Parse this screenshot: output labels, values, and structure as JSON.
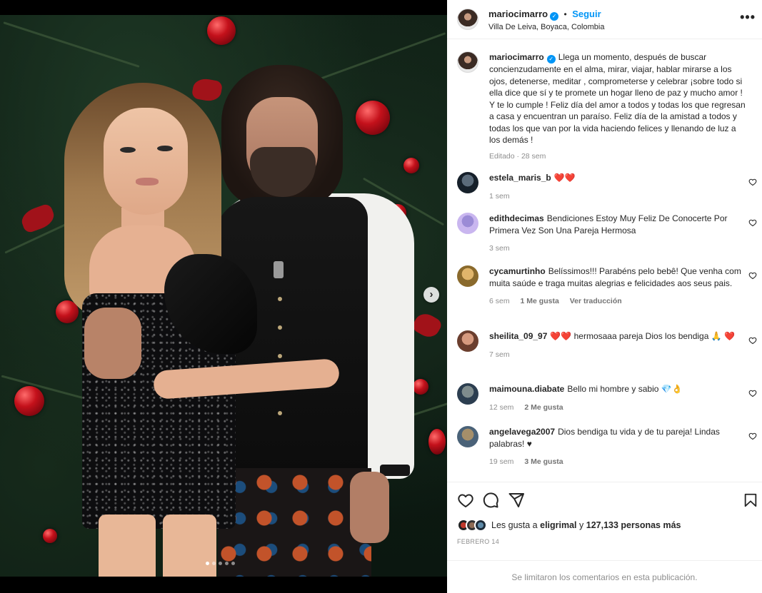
{
  "post": {
    "image_count": 5,
    "current_image": 1,
    "next_icon": "chevron-right-icon"
  },
  "header": {
    "username": "mariocimarro",
    "verified_icon": "verified-badge-icon",
    "separator": "•",
    "follow_label": "Seguir",
    "location": "Villa De Leiva, Boyaca, Colombia",
    "more_icon": "more-options-icon",
    "more_glyph": "•••"
  },
  "caption": {
    "username": "mariocimarro",
    "text": "Llega un momento, después de buscar concienzudamente en el alma, mirar, viajar, hablar mirarse a los ojos, detenerse, meditar , comprometerse y celebrar ¡sobre todo si ella dice que sí y te promete un hogar lleno de paz y mucho amor ! Y te lo cumple ! Feliz día del amor a todos y todas los que regresan a casa y encuentran un paraíso. Feliz día de la amistad a todos y todas los que van por la vida haciendo felices y llenando de luz a los demás !",
    "meta": "Editado · 28 sem"
  },
  "comments": [
    {
      "username": "estela_maris_b",
      "text": "❤️❤️",
      "time": "1 sem",
      "likes": "",
      "extra": ""
    },
    {
      "username": "edithdecimas",
      "text": "Bendiciones Estoy Muy Feliz De Conocerte Por Primera Vez Son Una Pareja Hermosa",
      "time": "3 sem",
      "likes": "",
      "extra": ""
    },
    {
      "username": "cycamurtinho",
      "text": "Belíssimos!!! Parabéns pelo bebê! Que venha com muita saúde e traga muitas alegrias e felicidades aos seus pais.",
      "time": "6 sem",
      "likes": "1 Me gusta",
      "extra": "Ver traducción"
    },
    {
      "username": "sheilita_09_97",
      "text": "❤️❤️ hermosaaa pareja Dios los bendiga 🙏 ❤️",
      "time": "7 sem",
      "likes": "",
      "extra": ""
    },
    {
      "username": "maimouna.diabate",
      "text": "Bello mi hombre y sabio 💎👌",
      "time": "12 sem",
      "likes": "2 Me gusta",
      "extra": ""
    },
    {
      "username": "angelavega2007",
      "text": "Dios bendiga tu vida y de tu pareja! Lindas palabras! ♥",
      "time": "19 sem",
      "likes": "3 Me gusta",
      "extra": ""
    }
  ],
  "actions": {
    "like_icon": "heart-icon",
    "comment_icon": "comment-icon",
    "share_icon": "share-icon",
    "save_icon": "bookmark-icon"
  },
  "likes": {
    "prefix": "Les gusta a",
    "user": "eligrimal",
    "conj": "y",
    "count": "127,133 personas más"
  },
  "date": "FEBRERO 14",
  "footer": "Se limitaron los comentarios en esta publicación."
}
